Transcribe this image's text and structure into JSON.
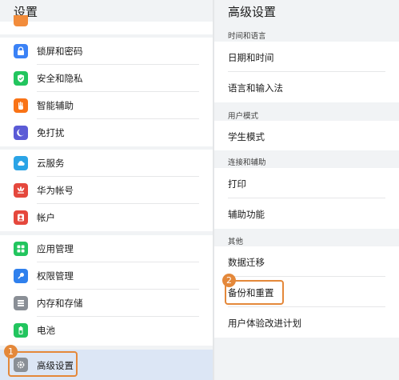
{
  "left": {
    "title": "设置",
    "items": [
      {
        "label": "锁屏和密码",
        "icon": "lock-icon",
        "color": "#3b82f6"
      },
      {
        "label": "安全和隐私",
        "icon": "shield-icon",
        "color": "#22c55e"
      },
      {
        "label": "智能辅助",
        "icon": "hand-icon",
        "color": "#f97316"
      },
      {
        "label": "免打扰",
        "icon": "moon-icon",
        "color": "#5b5bd6"
      },
      {
        "label": "云服务",
        "icon": "cloud-icon",
        "color": "#2ba4e6"
      },
      {
        "label": "华为帐号",
        "icon": "huawei-icon",
        "color": "#e5483d"
      },
      {
        "label": "帐户",
        "icon": "user-icon",
        "color": "#e5483d"
      },
      {
        "label": "应用管理",
        "icon": "apps-icon",
        "color": "#22c55e"
      },
      {
        "label": "权限管理",
        "icon": "key-icon",
        "color": "#2f80ed"
      },
      {
        "label": "内存和存储",
        "icon": "storage-icon",
        "color": "#8a8f96"
      },
      {
        "label": "电池",
        "icon": "battery-icon",
        "color": "#22c55e"
      },
      {
        "label": "高级设置",
        "icon": "gear-icon",
        "color": "#8a8f96"
      }
    ]
  },
  "right": {
    "title": "高级设置",
    "sections": {
      "time": "时间和语言",
      "user_mode": "用户模式",
      "connect": "连接和辅助",
      "other": "其他"
    },
    "items": {
      "datetime": "日期和时间",
      "language": "语言和输入法",
      "student": "学生模式",
      "print": "打印",
      "assist": "辅助功能",
      "migrate": "数据迁移",
      "backup": "备份和重置",
      "ux": "用户体验改进计划"
    }
  },
  "callouts": {
    "one": "1",
    "two": "2"
  },
  "colors": {
    "accent": "#e4883a",
    "selected_bg": "#dce6f5"
  }
}
